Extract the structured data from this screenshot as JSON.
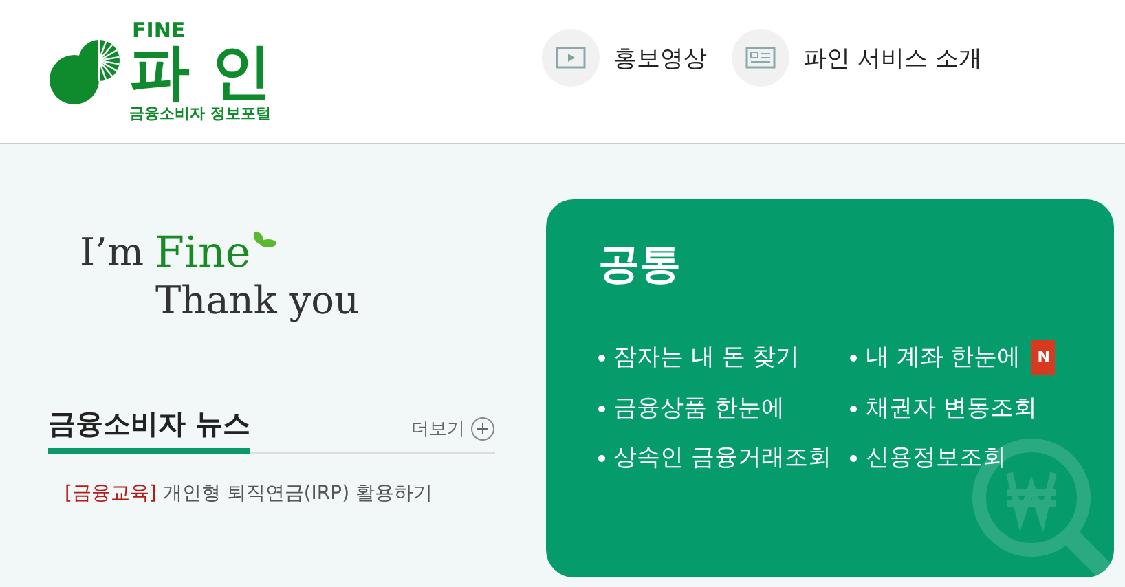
{
  "logo": {
    "top": "FINE",
    "name": "파 인",
    "subtitle": "금융소비자 정보포털"
  },
  "header_links": [
    {
      "kind": "video",
      "label": "홍보영상"
    },
    {
      "kind": "document",
      "label": "파인 서비스 소개"
    }
  ],
  "slogan": {
    "line_1_prefix": "I’m",
    "line_1_highlight": "Fine",
    "line_2": "Thank you"
  },
  "news": {
    "title": "금융소비자 뉴스",
    "more": "더보기",
    "items": [
      {
        "tag": "[금융교육]",
        "title": "개인형 퇴직연금(IRP) 활용하기"
      }
    ]
  },
  "card": {
    "title": "공통",
    "items": [
      {
        "label": "잠자는 내 돈 찾기"
      },
      {
        "label": "내 계좌 한눈에",
        "badge": "N"
      },
      {
        "label": "금융상품 한눈에"
      },
      {
        "label": "채권자 변동조회"
      },
      {
        "label": "상속인 금융거래조회"
      },
      {
        "label": "신용정보조회"
      }
    ]
  }
}
